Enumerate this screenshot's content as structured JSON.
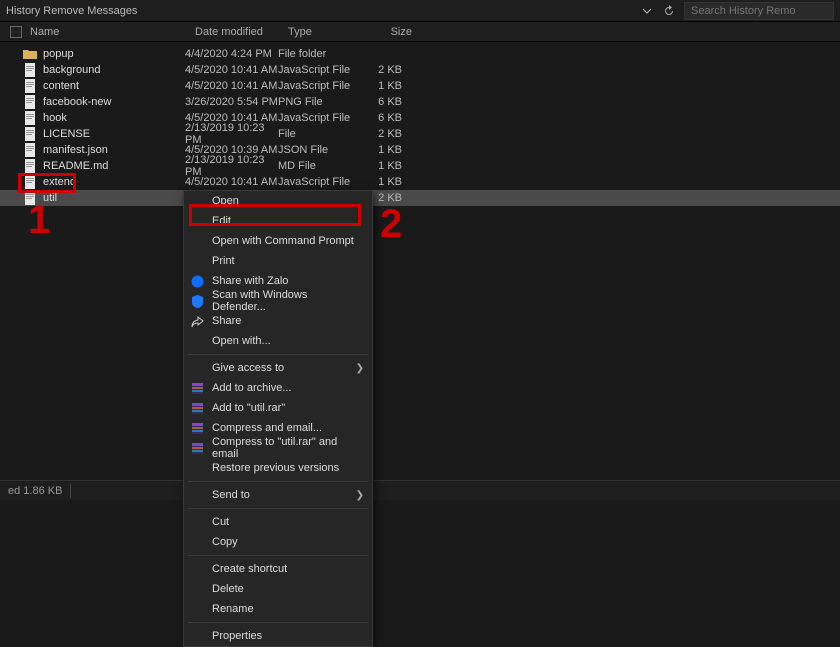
{
  "titlebar": {
    "title": "History Remove Messages",
    "search_placeholder": "Search History Remo"
  },
  "columns": {
    "name": "Name",
    "date": "Date modified",
    "type": "Type",
    "size": "Size"
  },
  "files": [
    {
      "icon": "folder",
      "name": "popup",
      "date": "4/4/2020 4:24 PM",
      "type": "File folder",
      "size": ""
    },
    {
      "icon": "js",
      "name": "background",
      "date": "4/5/2020 10:41 AM",
      "type": "JavaScript File",
      "size": "2 KB"
    },
    {
      "icon": "js",
      "name": "content",
      "date": "4/5/2020 10:41 AM",
      "type": "JavaScript File",
      "size": "1 KB"
    },
    {
      "icon": "png",
      "name": "facebook-new",
      "date": "3/26/2020 5:54 PM",
      "type": "PNG File",
      "size": "6 KB"
    },
    {
      "icon": "js",
      "name": "hook",
      "date": "4/5/2020 10:41 AM",
      "type": "JavaScript File",
      "size": "6 KB"
    },
    {
      "icon": "file",
      "name": "LICENSE",
      "date": "2/13/2019 10:23 PM",
      "type": "File",
      "size": "2 KB"
    },
    {
      "icon": "json",
      "name": "manifest.json",
      "date": "4/5/2020 10:39 AM",
      "type": "JSON File",
      "size": "1 KB"
    },
    {
      "icon": "md",
      "name": "README.md",
      "date": "2/13/2019 10:23 PM",
      "type": "MD File",
      "size": "1 KB"
    },
    {
      "icon": "js",
      "name": "extend",
      "date": "4/5/2020 10:41 AM",
      "type": "JavaScript File",
      "size": "1 KB"
    },
    {
      "icon": "js",
      "name": "util",
      "date": "",
      "type": "",
      "size": "2 KB",
      "selected": true
    }
  ],
  "context_menu": [
    {
      "label": "Open",
      "type": "item"
    },
    {
      "label": "Edit",
      "type": "item",
      "highlighted": true
    },
    {
      "label": "Open with Command Prompt",
      "type": "item"
    },
    {
      "label": "Print",
      "type": "item"
    },
    {
      "label": "Share with Zalo",
      "type": "item",
      "icon": "zalo"
    },
    {
      "label": "Scan with Windows Defender...",
      "type": "item",
      "icon": "defender"
    },
    {
      "label": "Share",
      "type": "item",
      "icon": "share"
    },
    {
      "label": "Open with...",
      "type": "item"
    },
    {
      "type": "sep"
    },
    {
      "label": "Give access to",
      "type": "item",
      "submenu": true
    },
    {
      "label": "Add to archive...",
      "type": "item",
      "icon": "rar"
    },
    {
      "label": "Add to \"util.rar\"",
      "type": "item",
      "icon": "rar"
    },
    {
      "label": "Compress and email...",
      "type": "item",
      "icon": "rar"
    },
    {
      "label": "Compress to \"util.rar\" and email",
      "type": "item",
      "icon": "rar"
    },
    {
      "label": "Restore previous versions",
      "type": "item"
    },
    {
      "type": "sep"
    },
    {
      "label": "Send to",
      "type": "item",
      "submenu": true
    },
    {
      "type": "sep"
    },
    {
      "label": "Cut",
      "type": "item"
    },
    {
      "label": "Copy",
      "type": "item"
    },
    {
      "type": "sep"
    },
    {
      "label": "Create shortcut",
      "type": "item"
    },
    {
      "label": "Delete",
      "type": "item"
    },
    {
      "label": "Rename",
      "type": "item"
    },
    {
      "type": "sep"
    },
    {
      "label": "Properties",
      "type": "item"
    }
  ],
  "annotations": {
    "n1": "1",
    "n2": "2"
  },
  "statusbar": {
    "text": "ed   1.86 KB"
  }
}
